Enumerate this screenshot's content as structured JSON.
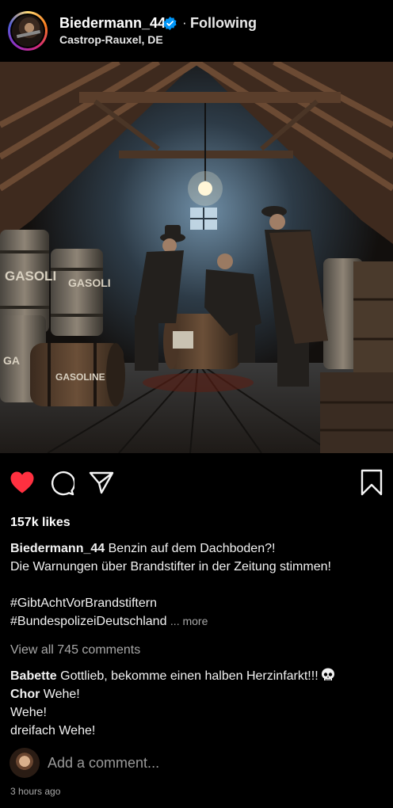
{
  "post": {
    "username": "Biedermann_44",
    "separator": "·",
    "follow_status": "Following",
    "location": "Castrop-Rauxel, DE",
    "likes": "157k likes",
    "caption_user": "Biedermann_44",
    "caption_line1": "Benzin auf dem Dachboden?!",
    "caption_line2": "Die Warnungen über Brandstifter in der Zeitung stimmen!",
    "hashtag1": "#GibtAchtVorBrandstiftern",
    "hashtag2": "#BundespolizeiDeutschland",
    "more_label": "... more",
    "view_all": "View all 745 comments",
    "timestamp": "3 hours ago"
  },
  "photo": {
    "barrel_labels": [
      "GASOLI",
      "GASOLI",
      "GASOLINE",
      "GA"
    ]
  },
  "comments": [
    {
      "user": "Babette",
      "text": "Gottlieb, bekomme einen halben Herzinfarkt!!!"
    },
    {
      "user": "Chor",
      "text": "Wehe!"
    }
  ],
  "comment_extra_lines": [
    "Wehe!",
    "dreifach Wehe!"
  ],
  "add_comment": {
    "placeholder": "Add a comment..."
  },
  "icons": {
    "like": "heart-filled-icon",
    "comment": "comment-bubble-icon",
    "share": "paper-plane-icon",
    "save": "bookmark-icon",
    "verified": "verified-badge-icon",
    "emoji": "skull-icon"
  },
  "colors": {
    "like_red": "#ff3040",
    "verified_blue": "#0095f6",
    "muted": "#a8a8a8"
  }
}
